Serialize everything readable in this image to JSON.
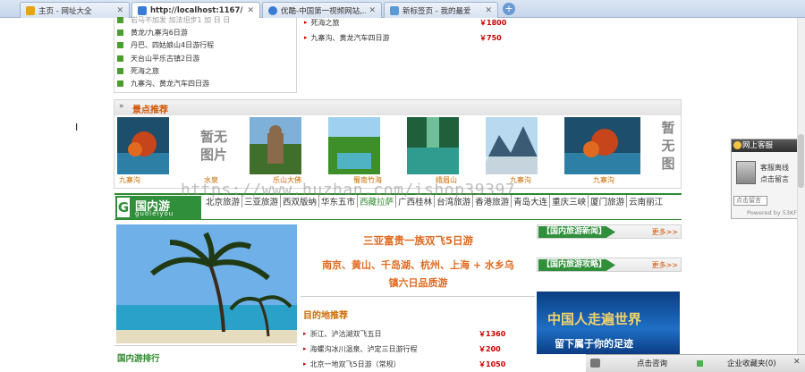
{
  "tabs": [
    {
      "label": "主页 - 网址大全",
      "active": false,
      "color": "#e8a317"
    },
    {
      "label": "http://localhost:1167/",
      "active": true,
      "color": "#3a7bd5"
    },
    {
      "label": "优酷-中国第一视频网站,...",
      "active": false,
      "color": "#3a7bd5"
    },
    {
      "label": "新标签页 - 我的最爱",
      "active": false,
      "color": "#5b9bd5"
    }
  ],
  "top_list_left": [
    "岩马不加发 加法坦步1 加 日 日",
    "黄龙/九寨沟6日游",
    "丹巴、四姑娘山4日游行程",
    "天台山平乐古镇2日游",
    "死海之旅",
    "九寨沟、黄龙汽车四日游"
  ],
  "top_list_right": [
    {
      "name": "死海之旅",
      "price": "￥1800"
    },
    {
      "name": "九寨沟、黄龙汽车四日游",
      "price": "￥750"
    }
  ],
  "scenic": {
    "title": "景点推荐",
    "no_image": "暂无图片",
    "captions": [
      "九寨沟",
      "水泉",
      "乐山大佛",
      "蜀南竹海",
      "峨眉山",
      "九寨沟",
      "九寨沟"
    ]
  },
  "domestic": {
    "letter": "G",
    "title": "国内游",
    "pinyin": "guoleiyou",
    "cities": [
      "北京旅游",
      "三亚旅游",
      "西双版纳",
      "华东五市",
      "西藏拉萨",
      "广西桂林",
      "台湾旅游",
      "香港旅游",
      "青岛大连",
      "重庆三峡",
      "厦门旅游",
      "云南丽江"
    ]
  },
  "promo": {
    "line1": "三亚富贵一族双飞5日游",
    "line2": "南京、黄山、千岛湖、杭州、上海 + 水乡乌",
    "line3": "镇六日品质游"
  },
  "destinations": {
    "title": "目的地推荐",
    "items": [
      {
        "name": "浙江、泸沽湖双飞五日",
        "price": "￥1360"
      },
      {
        "name": "海螺沟冰川温泉、泸定三日游行程",
        "price": "￥200"
      },
      {
        "name": "北京一地双飞5日游（常规）",
        "price": "￥1050"
      }
    ]
  },
  "rank_title": "国内游排行",
  "right_boxes": [
    {
      "label": "【国内旅游新闻】",
      "more": "更多>>"
    },
    {
      "label": "【国内旅游攻略】",
      "more": "更多>>"
    }
  ],
  "banner": {
    "line1": "中国人走遍世界",
    "line2": "留下属于你的足迹"
  },
  "chat": {
    "title": "网上客服",
    "line1": "客服离线",
    "line2": "点击留言",
    "input": "点击留言",
    "powered": "Powered by 53KF"
  },
  "statusbar": {
    "consult": "点击咨询",
    "favorites": "企业收藏夹(0)"
  },
  "watermark": "https://www.huzhan.com/ishop39397"
}
